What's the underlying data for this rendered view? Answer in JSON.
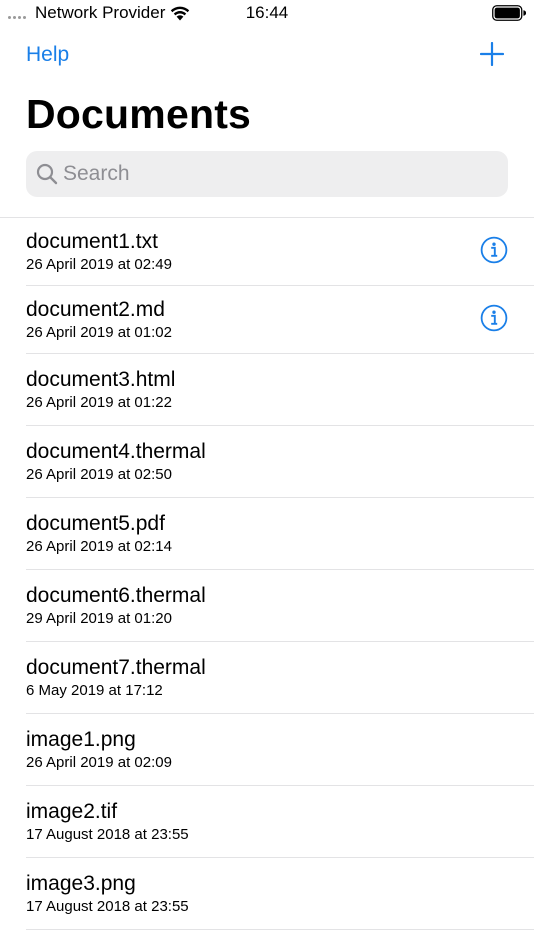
{
  "status_bar": {
    "carrier": "Network Provider",
    "time": "16:44"
  },
  "nav": {
    "left_label": "Help",
    "title": "Documents"
  },
  "search": {
    "placeholder": "Search"
  },
  "colors": {
    "accent": "#1a7fe8",
    "search_bg": "#eeeeef",
    "separator": "#e3e3e5"
  },
  "files": [
    {
      "name": "document1.txt",
      "date": "26 April 2019 at 02:49",
      "has_info": true
    },
    {
      "name": "document2.md",
      "date": "26 April 2019 at 01:02",
      "has_info": true
    },
    {
      "name": "document3.html",
      "date": "26 April 2019 at 01:22",
      "has_info": false
    },
    {
      "name": "document4.thermal",
      "date": "26 April 2019 at 02:50",
      "has_info": false
    },
    {
      "name": "document5.pdf",
      "date": "26 April 2019 at 02:14",
      "has_info": false
    },
    {
      "name": "document6.thermal",
      "date": "29 April 2019 at 01:20",
      "has_info": false
    },
    {
      "name": "document7.thermal",
      "date": "6 May 2019 at 17:12",
      "has_info": false
    },
    {
      "name": "image1.png",
      "date": "26 April 2019 at 02:09",
      "has_info": false
    },
    {
      "name": "image2.tif",
      "date": "17 August 2018 at 23:55",
      "has_info": false
    },
    {
      "name": "image3.png",
      "date": "17 August 2018 at 23:55",
      "has_info": false
    }
  ]
}
